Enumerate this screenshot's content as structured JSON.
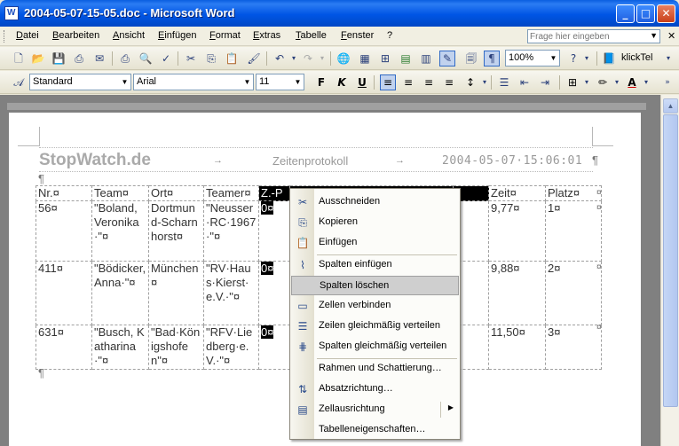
{
  "window": {
    "title": "2004-05-07-15-05.doc - Microsoft Word",
    "app_icon_letter": "W",
    "minimize": "_",
    "maximize": "□",
    "close": "✕"
  },
  "menubar": {
    "items": [
      "Datei",
      "Bearbeiten",
      "Ansicht",
      "Einfügen",
      "Format",
      "Extras",
      "Tabelle",
      "Fenster",
      "?"
    ],
    "help_placeholder": "Frage hier eingeben",
    "help_dropdown": "▼",
    "doc_close": "✕"
  },
  "standard_toolbar": {
    "zoom": "100%",
    "klicktel": "klickTel",
    "icons": [
      "new-icon",
      "open-icon",
      "save-icon",
      "permission-icon",
      "email-icon",
      "print-icon",
      "print-preview-icon",
      "spelling-icon",
      "cut-icon",
      "copy-icon",
      "paste-icon",
      "format-painter-icon",
      "undo-icon",
      "redo-icon",
      "hyperlink-icon",
      "tables-borders-icon",
      "insert-table-icon",
      "insert-excel-icon",
      "columns-icon",
      "drawing-icon",
      "document-map-icon",
      "show-formatting-icon",
      "help-icon",
      "klicktel-icon"
    ]
  },
  "formatting_toolbar": {
    "style": "Standard",
    "font": "Arial",
    "size": "11",
    "bold": "F",
    "italic": "K",
    "underline": "U"
  },
  "header": {
    "brand": "StopWatch.de",
    "arrow1": "→",
    "title": "Zeitenprotokoll",
    "arrow2": "→",
    "date": "2004-05-07·15:06:01",
    "pilcrow": "¶"
  },
  "table": {
    "rows": [
      [
        "Nr.¤",
        "Team¤",
        "Ort¤",
        "Teamer¤",
        "Z.-P",
        "",
        "",
        "Zeit¤",
        "Platz¤"
      ],
      [
        "56¤",
        "\"Boland, Veronika·\"¤",
        "Dortmund-Scharnhorst¤",
        "\"Neusser·RC·1967·\"¤",
        "0¤",
        "",
        "",
        "9,77¤",
        "1¤"
      ],
      [
        "411¤",
        "\"Bödicker, Anna·\"¤",
        "München¤",
        "\"RV·Haus·Kierst·e.V.·\"¤",
        "0¤",
        "",
        "",
        "9,88¤",
        "2¤"
      ],
      [
        "631¤",
        "\"Busch, Katharina·\"¤",
        "\"Bad·Königshofen\"¤",
        "\"RFV·Liedberg·e.V.·\"¤",
        "0¤",
        "",
        "",
        "11,50¤",
        "3¤"
      ]
    ],
    "end_of_row_mark": "¤",
    "after_pilcrow": "¶"
  },
  "context_menu": {
    "items": [
      {
        "icon": "✂",
        "icon_name": "cut-icon",
        "label": "Ausschneiden"
      },
      {
        "icon": "⎘",
        "icon_name": "copy-icon",
        "label": "Kopieren"
      },
      {
        "icon": "📋",
        "icon_name": "paste-icon",
        "label": "Einfügen"
      },
      {
        "icon": "⌇",
        "icon_name": "insert-columns-icon",
        "label": "Spalten einfügen"
      },
      {
        "icon": "",
        "icon_name": "",
        "label": "Spalten löschen",
        "highlighted": true
      },
      {
        "icon": "▭",
        "icon_name": "merge-cells-icon",
        "label": "Zellen verbinden"
      },
      {
        "icon": "☰",
        "icon_name": "distribute-rows-icon",
        "label": "Zeilen gleichmäßig verteilen"
      },
      {
        "icon": "⋕",
        "icon_name": "distribute-columns-icon",
        "label": "Spalten gleichmäßig verteilen"
      },
      {
        "icon": "",
        "icon_name": "",
        "label": "Rahmen und Schattierung…"
      },
      {
        "icon": "⇅",
        "icon_name": "text-direction-icon",
        "label": "Absatzrichtung…"
      },
      {
        "icon": "▤",
        "icon_name": "cell-alignment-icon",
        "label": "Zellausrichtung",
        "submenu": "▶"
      },
      {
        "icon": "",
        "icon_name": "",
        "label": "Tabelleneigenschaften…"
      }
    ]
  }
}
